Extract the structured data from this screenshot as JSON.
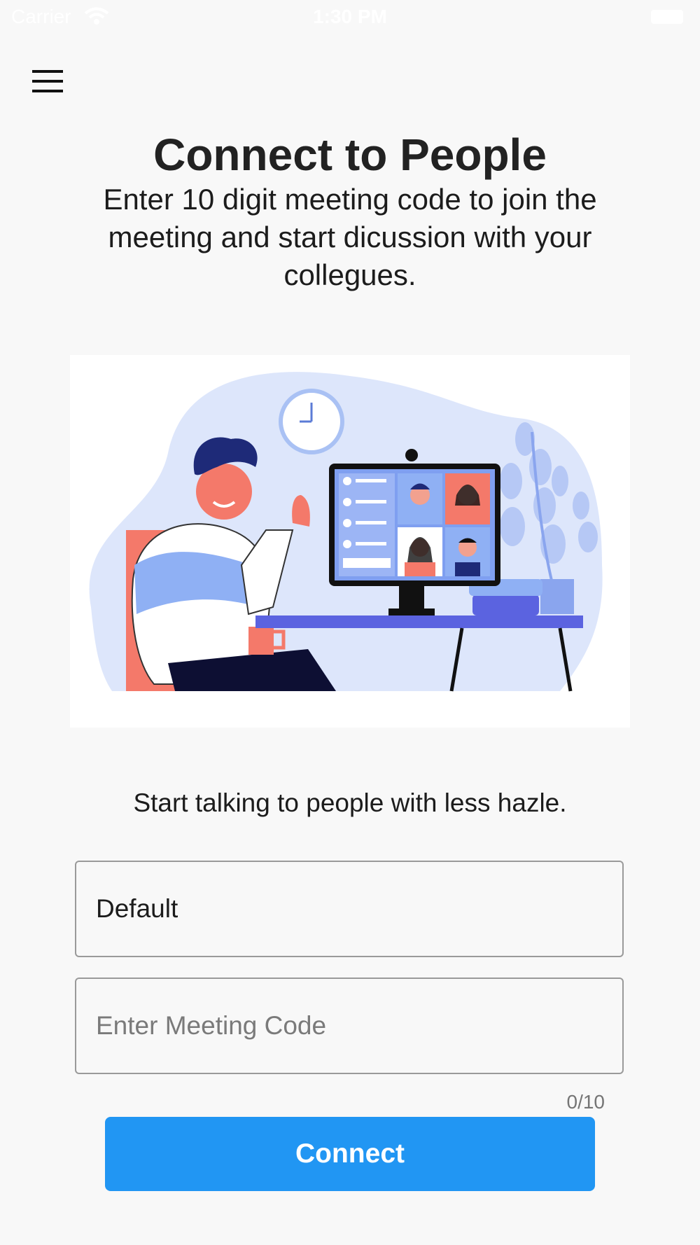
{
  "status_bar": {
    "carrier": "Carrier",
    "time": "1:30 PM"
  },
  "header": {
    "menu_icon": "hamburger-menu-icon"
  },
  "main": {
    "title": "Connect to People",
    "subtitle": "Enter 10 digit meeting code to join the meeting and start dicussion with your collegues.",
    "tagline": "Start talking to people with less hazle."
  },
  "form": {
    "name_field": {
      "value": "Default",
      "placeholder": ""
    },
    "code_field": {
      "value": "",
      "placeholder": "Enter Meeting Code"
    },
    "counter": "0/10",
    "connect_label": "Connect"
  },
  "colors": {
    "background": "#f8f8f8",
    "accent": "#2196f3",
    "illustration_blob": "#dde6fb",
    "illustration_blue": "#5b63e0",
    "illustration_coral": "#f4796a"
  }
}
